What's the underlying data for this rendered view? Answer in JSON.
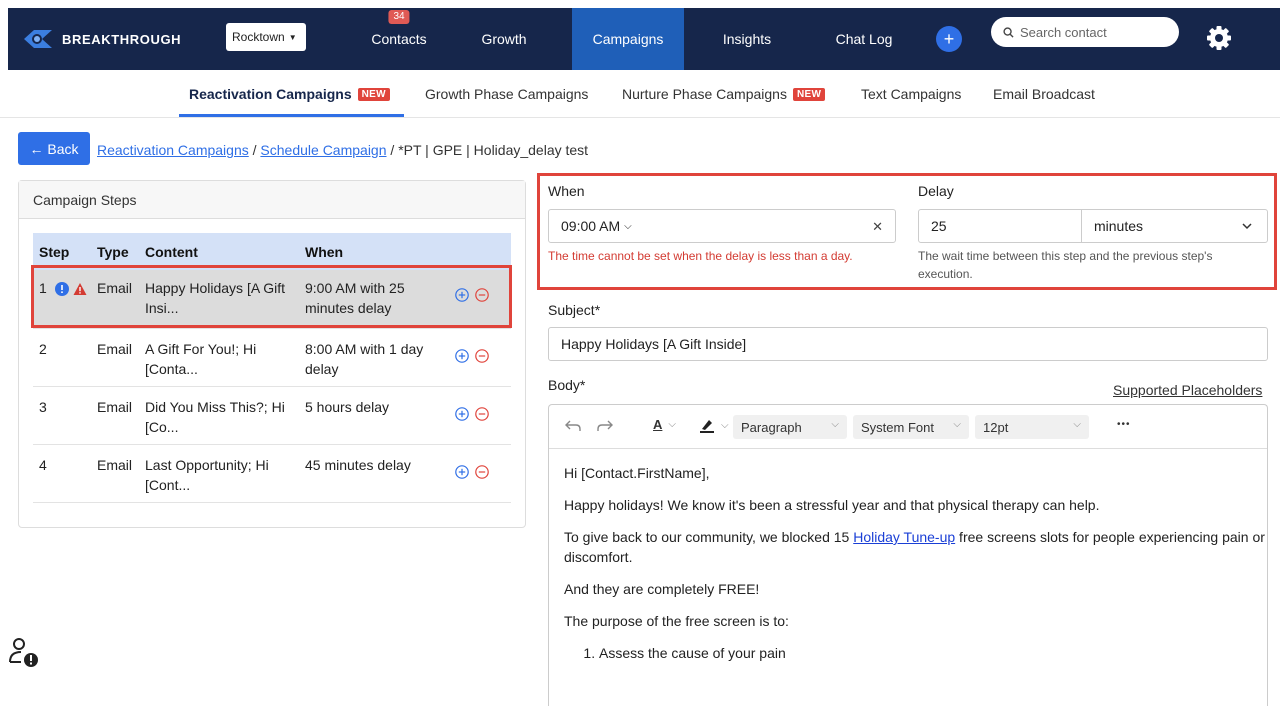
{
  "brand": {
    "name": "BREAKTHROUGH"
  },
  "location": {
    "selected": "Rocktown"
  },
  "nav": {
    "items": [
      {
        "label": "Contacts",
        "badge": "34"
      },
      {
        "label": "Growth"
      },
      {
        "label": "Campaigns"
      },
      {
        "label": "Insights"
      },
      {
        "label": "Chat Log"
      }
    ],
    "active": "Campaigns",
    "search_placeholder": "Search contact"
  },
  "subtabs": [
    {
      "label": "Reactivation Campaigns",
      "badge": "NEW"
    },
    {
      "label": "Growth Phase Campaigns"
    },
    {
      "label": "Nurture Phase Campaigns",
      "badge": "NEW"
    },
    {
      "label": "Text Campaigns"
    },
    {
      "label": "Email Broadcast"
    }
  ],
  "breadcrumb": {
    "back_label": "← Back",
    "link1": "Reactivation Campaigns",
    "sep": "/",
    "link2": "Schedule Campaign",
    "current": "*PT | GPE | Holiday_delay test"
  },
  "steps": {
    "title": "Campaign Steps",
    "columns": [
      "Step",
      "Type",
      "Content",
      "When"
    ],
    "rows": [
      {
        "step": "1",
        "type": "Email",
        "content": "Happy Holidays [A Gift Insi...",
        "when": "9:00 AM with 25 minutes delay"
      },
      {
        "step": "2",
        "type": "Email",
        "content": "A Gift For You!; Hi [Conta...",
        "when": "8:00 AM with 1 day delay"
      },
      {
        "step": "3",
        "type": "Email",
        "content": "Did You Miss This?; Hi [Co...",
        "when": "5 hours delay"
      },
      {
        "step": "4",
        "type": "Email",
        "content": "Last Opportunity; Hi [Cont...",
        "when": "45 minutes delay"
      }
    ]
  },
  "schedule": {
    "when_label": "When",
    "time_value": "09:00  AM",
    "error": "The time cannot be set when the delay is less than a day.",
    "delay_label": "Delay",
    "delay_value": "25",
    "delay_unit": "minutes",
    "delay_help": "The wait time between this step and the previous step's execution."
  },
  "subject": {
    "label": "Subject*",
    "value": "Happy Holidays [A Gift Inside]"
  },
  "body": {
    "label": "Body*",
    "placeholders_link": "Supported Placeholders",
    "toolbar": {
      "text_color": "A",
      "block": "Paragraph",
      "font": "System Font",
      "size": "12pt",
      "more": "•••"
    },
    "p1": "Hi [Contact.FirstName],",
    "p2": "Happy holidays! We know it's been a stressful year and that physical therapy can help.",
    "p3_pre": "To give back to our community, we blocked 15 ",
    "p3_link": "Holiday Tune-up",
    "p3_post": " free screens slots for people experiencing pain or discomfort.",
    "p4": "And they are completely FREE!",
    "p5": "The purpose of the free screen is to:",
    "list1": "Assess the cause of your pain"
  }
}
